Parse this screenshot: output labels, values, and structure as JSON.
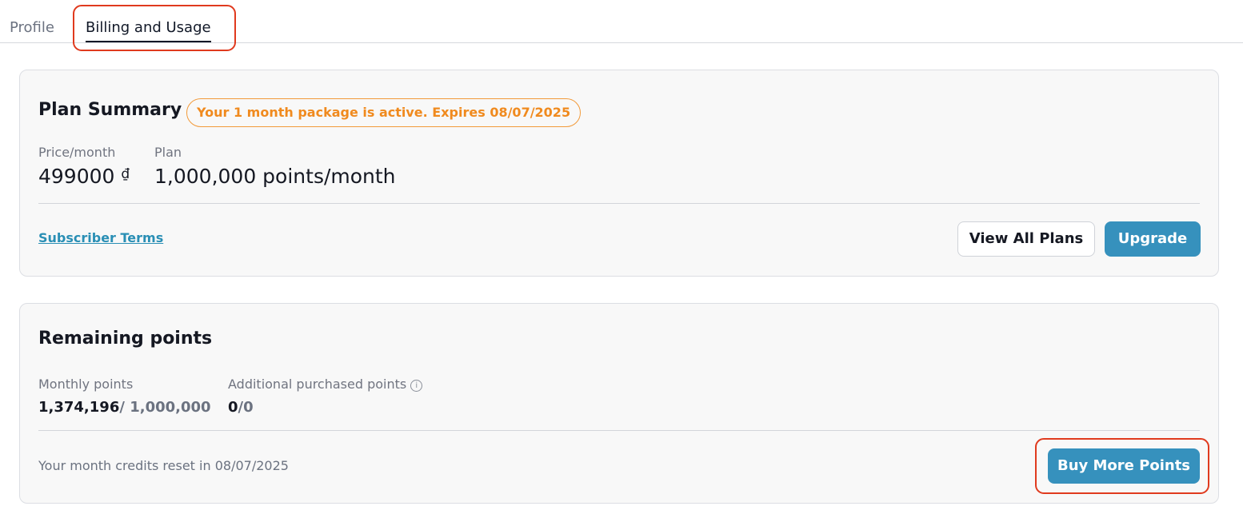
{
  "tabs": [
    {
      "label": "Profile",
      "active": false
    },
    {
      "label": "Billing and Usage",
      "active": true
    }
  ],
  "plan_summary": {
    "title": "Plan Summary",
    "badge": "Your 1 month package is active. Expires 08/07/2025",
    "price_label": "Price/month",
    "price_value": "499000",
    "currency_symbol": "₫",
    "plan_label": "Plan",
    "plan_value": "1,000,000 points/month",
    "terms_link": "Subscriber Terms",
    "view_all_plans_label": "View All Plans",
    "upgrade_label": "Upgrade"
  },
  "remaining_points": {
    "title": "Remaining points",
    "monthly_label": "Monthly points",
    "monthly_used": "1,374,196",
    "monthly_total": "/ 1,000,000",
    "additional_label": "Additional purchased points",
    "additional_used": "0",
    "additional_total": "/0",
    "reset_note": "Your month credits reset in 08/07/2025",
    "buy_more_label": "Buy More Points"
  },
  "colors": {
    "accent": "#3691bd",
    "badge": "#f08a1e",
    "highlight": "#e03a1e"
  },
  "icons": [
    "info-icon"
  ]
}
